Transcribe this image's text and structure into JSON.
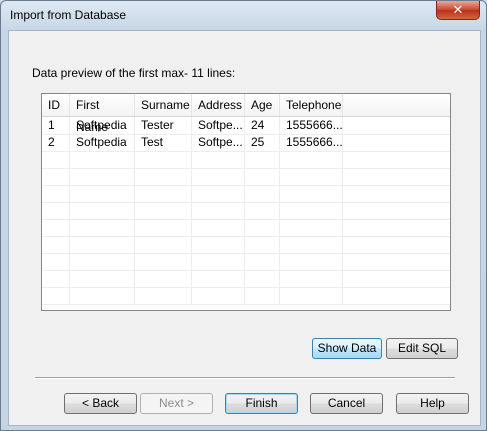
{
  "window": {
    "title": "Import from Database",
    "close_glyph": "✕"
  },
  "main": {
    "preview_label": "Data preview of the first max- 11 lines:"
  },
  "table": {
    "columns": [
      "ID",
      "First Name",
      "Surname",
      "Address",
      "Age",
      "Telephone",
      ""
    ],
    "rows": [
      [
        "1",
        "Softpedia",
        "Tester",
        "Softpe...",
        "24",
        "1555666...",
        ""
      ],
      [
        "2",
        "Softpedia",
        "Test",
        "Softpe...",
        "25",
        "1555666...",
        ""
      ]
    ],
    "empty_row_count": 9
  },
  "buttons": {
    "show_data": "Show Data",
    "edit_sql": "Edit SQL",
    "back": "< Back",
    "next": "Next >",
    "finish": "Finish",
    "cancel": "Cancel",
    "help": "Help"
  },
  "colors": {
    "accent": "#3c7fb1",
    "close_red": "#c7452b"
  }
}
